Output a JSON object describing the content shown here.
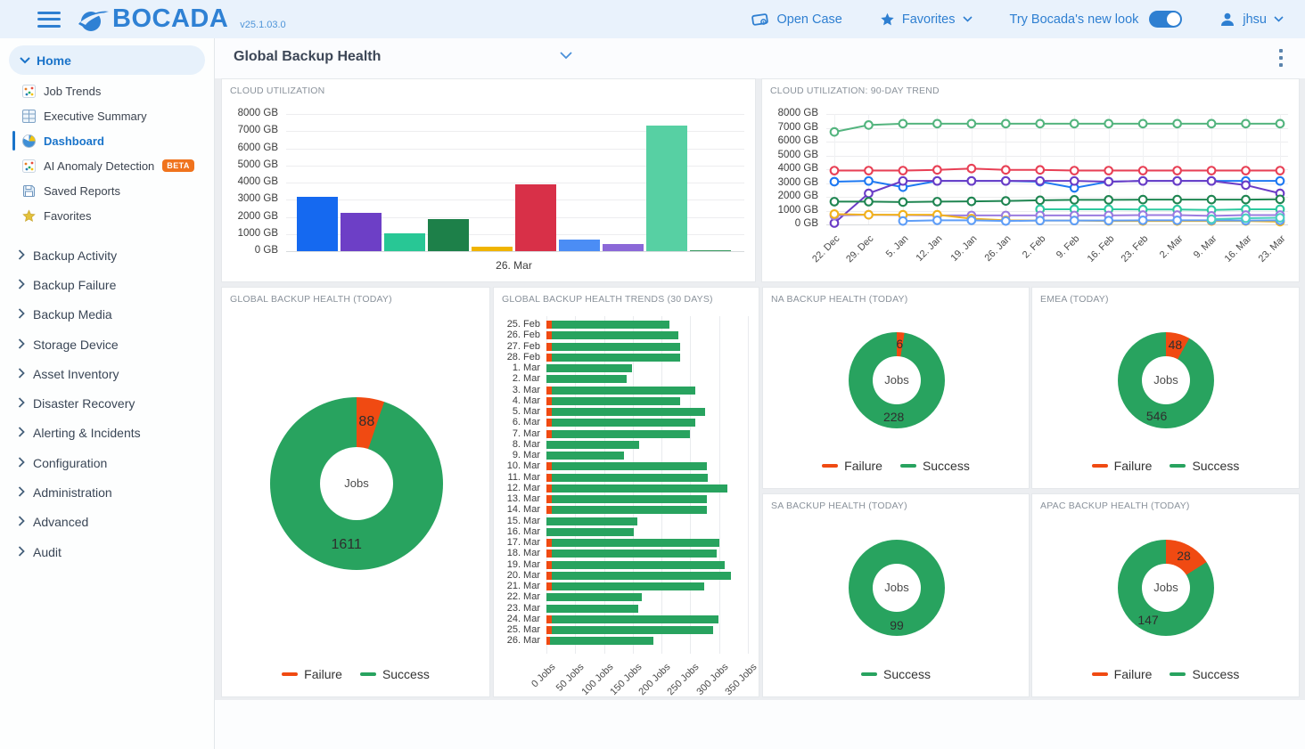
{
  "topbar": {
    "brand": "BOCADA",
    "version": "v25.1.03.0",
    "open_case_label": "Open Case",
    "favorites_label": "Favorites",
    "new_look_label": "Try Bocada's new look",
    "user_name": "jhsu"
  },
  "sidebar": {
    "home_label": "Home",
    "home_items": [
      {
        "label": "Job Trends",
        "icon": "scatter"
      },
      {
        "label": "Executive Summary",
        "icon": "table"
      },
      {
        "label": "Dashboard",
        "icon": "pie",
        "active": true
      },
      {
        "label": "AI Anomaly Detection",
        "icon": "scatter",
        "badge": "BETA"
      },
      {
        "label": "Saved Reports",
        "icon": "save"
      },
      {
        "label": "Favorites",
        "icon": "star"
      }
    ],
    "sections": [
      "Backup Activity",
      "Backup Failure",
      "Backup Media",
      "Storage Device",
      "Asset Inventory",
      "Disaster Recovery",
      "Alerting & Incidents",
      "Configuration",
      "Administration",
      "Advanced",
      "Audit"
    ]
  },
  "header": {
    "title": "Global Backup Health"
  },
  "colors": {
    "accent_blue": "#2e7fd1",
    "failure": "#f04a12",
    "success": "#28a35f"
  },
  "chart_data": [
    {
      "id": "cloud-utilization",
      "type": "bar",
      "title": "CLOUD UTILIZATION",
      "x_label": "26. Mar",
      "ylim": [
        0,
        8000
      ],
      "ytick_step": 1000,
      "yunit": "GB",
      "values": [
        3150,
        2250,
        1060,
        1850,
        280,
        3900,
        650,
        430,
        7300,
        60
      ],
      "colors": [
        "#1569f0",
        "#6d3fc6",
        "#28c795",
        "#1d8049",
        "#f0b400",
        "#d83048",
        "#4b8df5",
        "#8b68d8",
        "#57d0a3",
        "#35995e"
      ]
    },
    {
      "id": "cloud-trend",
      "type": "line",
      "title": "CLOUD UTILIZATION: 90-DAY TREND",
      "ylim": [
        0,
        8000
      ],
      "ytick_step": 1000,
      "yunit": "GB",
      "x": [
        "22. Dec",
        "29. Dec",
        "5. Jan",
        "12. Jan",
        "19. Jan",
        "26. Jan",
        "2. Feb",
        "9. Feb",
        "16. Feb",
        "23. Feb",
        "2. Mar",
        "9. Mar",
        "16. Mar",
        "23. Mar"
      ],
      "series": [
        {
          "name": "series-1",
          "color": "#53b47e",
          "values": [
            6700,
            7200,
            7300,
            7300,
            7300,
            7300,
            7300,
            7300,
            7300,
            7300,
            7300,
            7300,
            7300,
            7300
          ]
        },
        {
          "name": "series-2",
          "color": "#e84055",
          "values": [
            3900,
            3900,
            3900,
            3950,
            4050,
            3950,
            3950,
            3900,
            3900,
            3900,
            3900,
            3900,
            3900,
            3900
          ]
        },
        {
          "name": "series-3",
          "color": "#1d78f2",
          "values": [
            3100,
            3150,
            2700,
            3150,
            3150,
            3150,
            3100,
            2650,
            3100,
            3150,
            3150,
            3150,
            3150,
            3150
          ]
        },
        {
          "name": "series-4",
          "color": "#6a3cc6",
          "values": [
            100,
            2250,
            3150,
            3150,
            3150,
            3150,
            3150,
            3150,
            3100,
            3150,
            3150,
            3150,
            2850,
            2250
          ]
        },
        {
          "name": "series-5",
          "color": "#1f8551",
          "values": [
            1650,
            1650,
            1620,
            1650,
            1670,
            1700,
            1750,
            1780,
            1780,
            1800,
            1800,
            1800,
            1800,
            1820
          ]
        },
        {
          "name": "series-6",
          "color": "#2cc89e",
          "values": [
            null,
            null,
            null,
            null,
            null,
            null,
            1100,
            1100,
            1100,
            1080,
            1080,
            1050,
            1100,
            1100
          ]
        },
        {
          "name": "series-7",
          "color": "#9b7ce0",
          "values": [
            650,
            700,
            680,
            650,
            650,
            650,
            650,
            650,
            650,
            680,
            680,
            620,
            680,
            680
          ]
        },
        {
          "name": "series-8",
          "color": "#f2b21c",
          "values": [
            750,
            700,
            700,
            700,
            420,
            300,
            280,
            280,
            250,
            250,
            250,
            250,
            250,
            200
          ]
        },
        {
          "name": "series-9",
          "color": "#5f9ef8",
          "values": [
            null,
            null,
            250,
            300,
            300,
            250,
            280,
            280,
            280,
            300,
            300,
            300,
            280,
            300
          ]
        },
        {
          "name": "series-10",
          "color": "#49cfc0",
          "values": [
            null,
            null,
            null,
            null,
            null,
            null,
            null,
            null,
            null,
            null,
            null,
            380,
            450,
            480
          ]
        }
      ]
    },
    {
      "id": "global-health",
      "type": "donut",
      "title": "GLOBAL BACKUP HEALTH (TODAY)",
      "center_label": "Jobs",
      "legend": [
        "Failure",
        "Success"
      ],
      "slices": [
        {
          "name": "Failure",
          "value": 88,
          "color": "#f04a12"
        },
        {
          "name": "Success",
          "value": 1611,
          "color": "#28a35f"
        }
      ]
    },
    {
      "id": "health-trends",
      "type": "hbar_stacked",
      "title": "GLOBAL BACKUP HEALTH TRENDS (30 DAYS)",
      "xlim": [
        0,
        350
      ],
      "xtick_step": 50,
      "xunit": "Jobs",
      "failure_color": "#f04a12",
      "success_color": "#28a35f",
      "categories": [
        "25. Feb",
        "26. Feb",
        "27. Feb",
        "28. Feb",
        "1. Mar",
        "2. Mar",
        "3. Mar",
        "4. Mar",
        "5. Mar",
        "6. Mar",
        "7. Mar",
        "8. Mar",
        "9. Mar",
        "10. Mar",
        "11. Mar",
        "12. Mar",
        "13. Mar",
        "14. Mar",
        "15. Mar",
        "16. Mar",
        "17. Mar",
        "18. Mar",
        "19. Mar",
        "20. Mar",
        "21. Mar",
        "22. Mar",
        "23. Mar",
        "24. Mar",
        "25. Mar",
        "26. Mar"
      ],
      "failure": [
        9,
        9,
        9,
        9,
        0,
        0,
        9,
        9,
        9,
        9,
        9,
        0,
        0,
        9,
        9,
        9,
        9,
        9,
        0,
        0,
        9,
        9,
        9,
        9,
        9,
        0,
        0,
        9,
        9,
        6
      ],
      "success": [
        205,
        220,
        224,
        224,
        148,
        140,
        249,
        223,
        266,
        250,
        241,
        161,
        135,
        270,
        271,
        306,
        270,
        270,
        158,
        151,
        292,
        287,
        301,
        311,
        265,
        165,
        159,
        290,
        280,
        180
      ]
    },
    {
      "id": "na-health",
      "type": "donut",
      "title": "NA BACKUP HEALTH (TODAY)",
      "center_label": "Jobs",
      "legend": [
        "Failure",
        "Success"
      ],
      "slices": [
        {
          "name": "Failure",
          "value": 6,
          "color": "#f04a12"
        },
        {
          "name": "Success",
          "value": 228,
          "color": "#28a35f"
        }
      ]
    },
    {
      "id": "emea-health",
      "type": "donut",
      "title": "EMEA (TODAY)",
      "center_label": "Jobs",
      "legend": [
        "Failure",
        "Success"
      ],
      "slices": [
        {
          "name": "Failure",
          "value": 48,
          "color": "#f04a12"
        },
        {
          "name": "Success",
          "value": 546,
          "color": "#28a35f"
        }
      ]
    },
    {
      "id": "sa-health",
      "type": "donut",
      "title": "SA BACKUP HEALTH (TODAY)",
      "center_label": "Jobs",
      "legend": [
        "Success"
      ],
      "slices": [
        {
          "name": "Success",
          "value": 99,
          "color": "#28a35f"
        }
      ]
    },
    {
      "id": "apac-health",
      "type": "donut",
      "title": "APAC BACKUP HEALTH (TODAY)",
      "center_label": "Jobs",
      "legend": [
        "Failure",
        "Success"
      ],
      "slices": [
        {
          "name": "Failure",
          "value": 28,
          "color": "#f04a12"
        },
        {
          "name": "Success",
          "value": 147,
          "color": "#28a35f"
        }
      ]
    }
  ]
}
